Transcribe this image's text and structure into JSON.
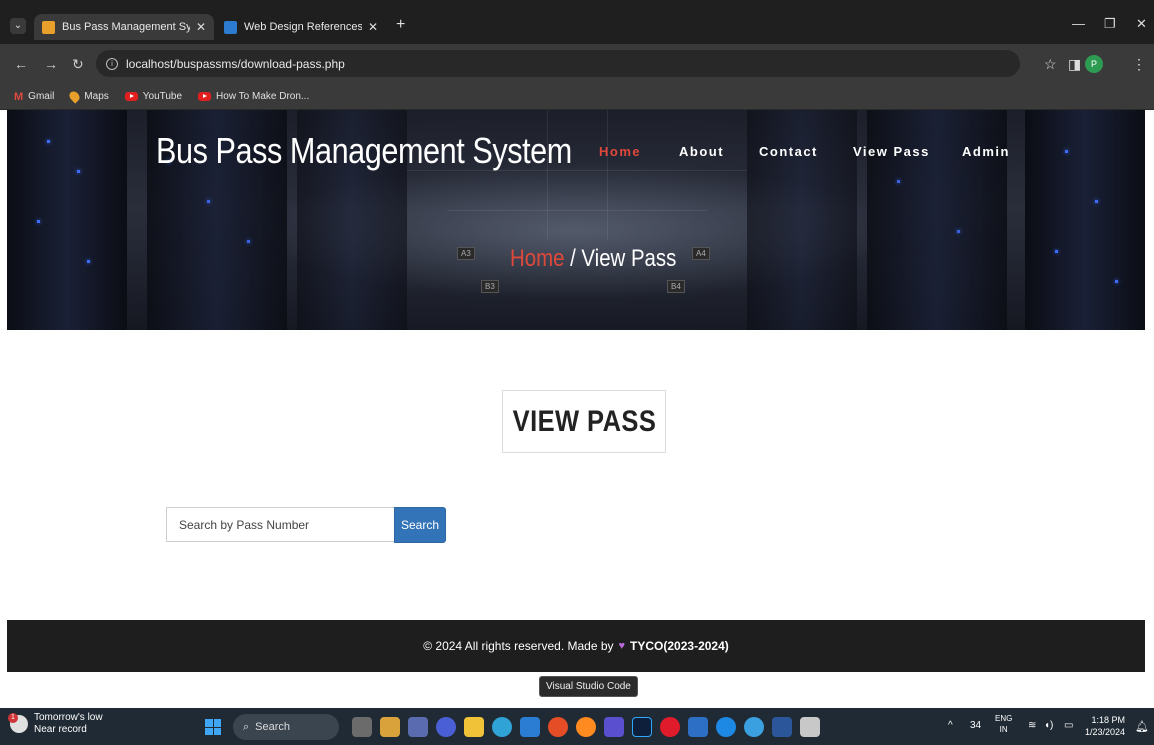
{
  "browser": {
    "tabs": [
      {
        "title": "Bus Pass Management System |",
        "active": true
      },
      {
        "title": "Web Design References: Books",
        "active": false
      }
    ],
    "url": "localhost/buspassms/download-pass.php",
    "bookmarks": [
      "Gmail",
      "Maps",
      "YouTube",
      "How To Make Dron..."
    ],
    "profile_initial": "P"
  },
  "site": {
    "title": "Bus Pass Management System",
    "nav": [
      "Home",
      "About",
      "Contact",
      "View Pass",
      "Admin"
    ],
    "breadcrumb_home": "Home",
    "breadcrumb_current": " / View Pass",
    "hero_signs": [
      "A3",
      "A4",
      "B3",
      "B4"
    ]
  },
  "main": {
    "heading": "VIEW PASS",
    "search_placeholder": "Search by Pass Number",
    "search_button": "Search"
  },
  "footer": {
    "prefix": "© 2024 All rights reserved. Made by",
    "brand": "TYCO(2023-2024)"
  },
  "tooltip": "Visual Studio Code",
  "taskbar": {
    "weather_line1": "Tomorrow's low",
    "weather_line2": "Near record",
    "search_label": "Search",
    "tray_number": "34",
    "lang_line1": "ENG",
    "lang_line2": "IN",
    "time": "1:18 PM",
    "date": "1/23/2024"
  },
  "colors": {
    "accent_red": "#e0483c",
    "button_blue": "#3374b8",
    "footer_bg": "#1e1e1e"
  }
}
